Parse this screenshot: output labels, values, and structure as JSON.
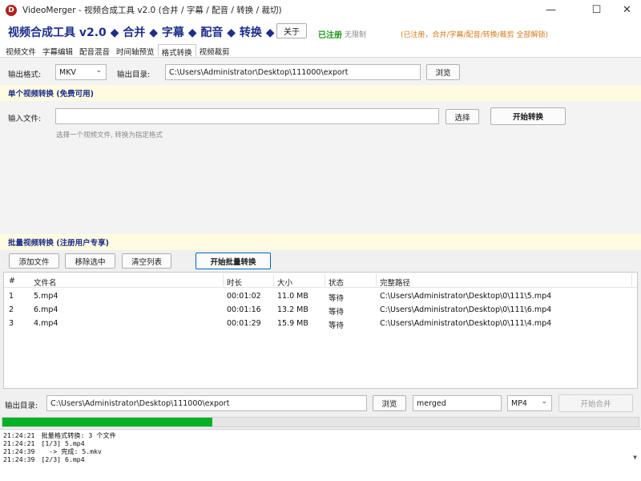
{
  "window": {
    "logo_letter": "D",
    "title": "VideoMerger - 视频合成工具 v2.0 (合并 / 字幕 / 配音 / 转换 / 裁切)",
    "min_glyph": "—",
    "max_glyph": "☐",
    "close_glyph": "✕"
  },
  "header": {
    "brand": "视频合成工具 v2.0  ◆ 合并 ◆ 字幕 ◆ 配音 ◆ 转换 ◆ 裁切",
    "about_label": "关于",
    "reg_status": "已注册",
    "reg_limit": "无限制",
    "reg_note": "(已注册，合并/字幕/配音/转换/裁剪 全部解锁)"
  },
  "tabs": [
    {
      "label": "视频文件",
      "active": false
    },
    {
      "label": "字幕编辑",
      "active": false
    },
    {
      "label": "配音混音",
      "active": false
    },
    {
      "label": "时间轴预览",
      "active": false
    },
    {
      "label": "格式转换",
      "active": true
    },
    {
      "label": "视频裁剪",
      "active": false
    }
  ],
  "convert": {
    "format_label": "输出格式:",
    "format_value": "MKV",
    "outdir_label": "输出目录:",
    "outdir_value": "C:\\Users\\Administrator\\Desktop\\111000\\export",
    "browse_label": "浏览",
    "single_header": "单个视频转换 (免费可用)",
    "input_label": "输入文件:",
    "input_value": "",
    "choose_label": "选择",
    "start_label": "开始转换",
    "hint": "选择一个视频文件, 转换为指定格式"
  },
  "batch": {
    "header": "批量视频转换 (注册用户专享)",
    "add_label": "添加文件",
    "remove_label": "移除选中",
    "clear_label": "清空列表",
    "start_label": "开始批量转换",
    "columns": [
      "#",
      "文件名",
      "时长",
      "大小",
      "状态",
      "完整路径"
    ],
    "rows": [
      {
        "idx": "1",
        "name": "5.mp4",
        "duration": "00:01:02",
        "size": "11.0 MB",
        "status": "等待",
        "path": "C:\\Users\\Administrator\\Desktop\\0\\111\\5.mp4"
      },
      {
        "idx": "2",
        "name": "6.mp4",
        "duration": "00:01:16",
        "size": "13.2 MB",
        "status": "等待",
        "path": "C:\\Users\\Administrator\\Desktop\\0\\111\\6.mp4"
      },
      {
        "idx": "3",
        "name": "4.mp4",
        "duration": "00:01:29",
        "size": "15.9 MB",
        "status": "等待",
        "path": "C:\\Users\\Administrator\\Desktop\\0\\111\\4.mp4"
      }
    ]
  },
  "merge": {
    "outdir_label": "输出目录:",
    "outdir_value": "C:\\Users\\Administrator\\Desktop\\111000\\export",
    "browse_label": "浏览",
    "name_value": "merged",
    "format_value": "MP4",
    "start_label": "开始合并"
  },
  "progress": {
    "fraction": 0.33
  },
  "log": [
    {
      "time": "21:24:21",
      "text": "批量格式转换: 3 个文件"
    },
    {
      "time": "21:24:21",
      "text": "[1/3] 5.mp4"
    },
    {
      "time": "21:24:39",
      "text": "  -> 完成: 5.mkv"
    },
    {
      "time": "21:24:39",
      "text": "[2/3] 6.mp4"
    }
  ],
  "colors": {
    "brand": "#1c2f8a",
    "registered": "#1a9a1a",
    "note": "#d77a1a",
    "progress": "#06b025",
    "section_bg": "#fffbe1"
  }
}
